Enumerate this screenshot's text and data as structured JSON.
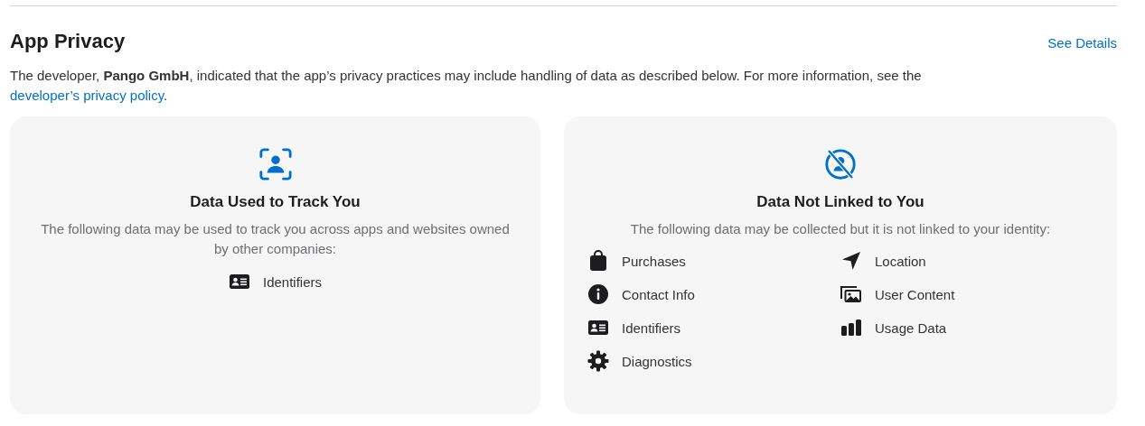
{
  "section": {
    "title": "App Privacy",
    "link": "See Details",
    "description_parts": [
      {
        "kind": "text",
        "text": "The developer, **Pango GmbH**, indicated that the app’s privacy practices may include handling of data as described below. For more information, see the "
      },
      {
        "kind": "link",
        "text": "developer’s privacy policy"
      },
      {
        "kind": "text",
        "text": "."
      }
    ]
  },
  "cards": [
    {
      "kind": "tracking",
      "title": "Data Used to Track You",
      "description": "The following data may be used to track you across apps and websites owned by other companies:",
      "items": [
        {
          "kind": "id-card",
          "label": "Identifiers"
        }
      ]
    },
    {
      "kind": "not-linked",
      "title": "Data Not Linked to You",
      "description": "The following data may be collected but it is not linked to your identity:",
      "items": [
        {
          "kind": "bag",
          "label": "Purchases"
        },
        {
          "kind": "location",
          "label": "Location"
        },
        {
          "kind": "info",
          "label": "Contact Info"
        },
        {
          "kind": "photos",
          "label": "User Content"
        },
        {
          "kind": "id-card",
          "label": "Identifiers"
        },
        {
          "kind": "bars",
          "label": "Usage Data"
        },
        {
          "kind": "gear",
          "label": "Diagnostics"
        }
      ]
    }
  ]
}
